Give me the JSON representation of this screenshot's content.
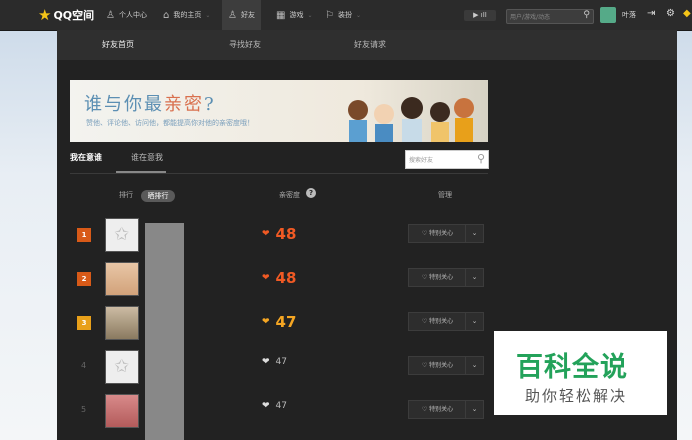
{
  "topbar": {
    "brand": "QQ空间",
    "nav": [
      "个人中心",
      "我的主页",
      "好友",
      "游戏",
      "装扮"
    ],
    "search_placeholder": "用户/游戏/动态",
    "username": "叶落"
  },
  "tabs": [
    "好友首页",
    "寻找好友",
    "好友请求"
  ],
  "banner": {
    "headline_part1": "谁与你最",
    "headline_hl": "亲密",
    "headline_q": "?",
    "subline": "赞他、评论他、访问他，都能提高你对他的亲密度哦！"
  },
  "subtabs": [
    "我在意谁",
    "谁在意我"
  ],
  "friend_search_placeholder": "搜索好友",
  "table_header": {
    "rank": "排行",
    "rank_btn": "晒排行",
    "intimacy": "亲密度",
    "manage": "管理"
  },
  "rows": [
    {
      "rank": "1",
      "score": "48",
      "action": "特别关心"
    },
    {
      "rank": "2",
      "score": "48",
      "action": "特别关心"
    },
    {
      "rank": "3",
      "score": "47",
      "action": "特别关心"
    },
    {
      "rank": "4",
      "score": "47",
      "action": "特别关心"
    },
    {
      "rank": "5",
      "score": "47",
      "action": "特别关心"
    }
  ],
  "watermark": {
    "line1": "百科全说",
    "line2": "助你轻松解决"
  }
}
